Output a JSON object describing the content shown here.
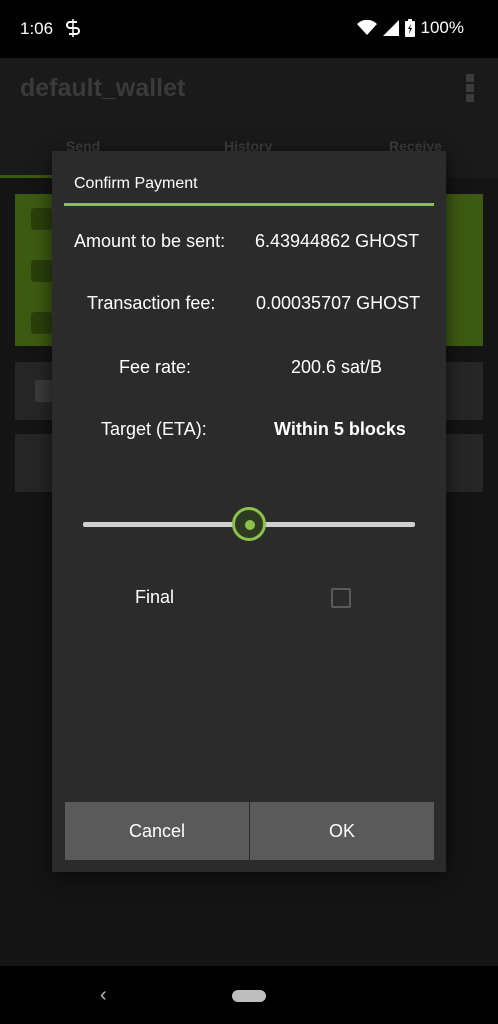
{
  "status_bar": {
    "time": "1:06",
    "battery": "100%"
  },
  "app": {
    "title": "default_wallet",
    "tabs": [
      "Send",
      "History",
      "Receive"
    ]
  },
  "dialog": {
    "title": "Confirm Payment",
    "rows": [
      {
        "label": "Amount to be sent:",
        "value": "6.43944862 GHOST"
      },
      {
        "label": "Transaction fee:",
        "value": "0.00035707 GHOST"
      },
      {
        "label": "Fee rate:",
        "value": "200.6 sat/B"
      },
      {
        "label": "Target (ETA):",
        "value": "Within 5 blocks"
      }
    ],
    "slider_value": 0.5,
    "final_label": "Final",
    "final_checked": false,
    "cancel_label": "Cancel",
    "ok_label": "OK"
  },
  "colors": {
    "accent": "#8bc34a",
    "dialog_bg": "#2b2b2b",
    "button_bg": "#5a5a5a"
  },
  "icons": [
    "s-icon",
    "wifi-icon",
    "signal-icon",
    "battery-icon",
    "back-icon",
    "home-pill"
  ]
}
